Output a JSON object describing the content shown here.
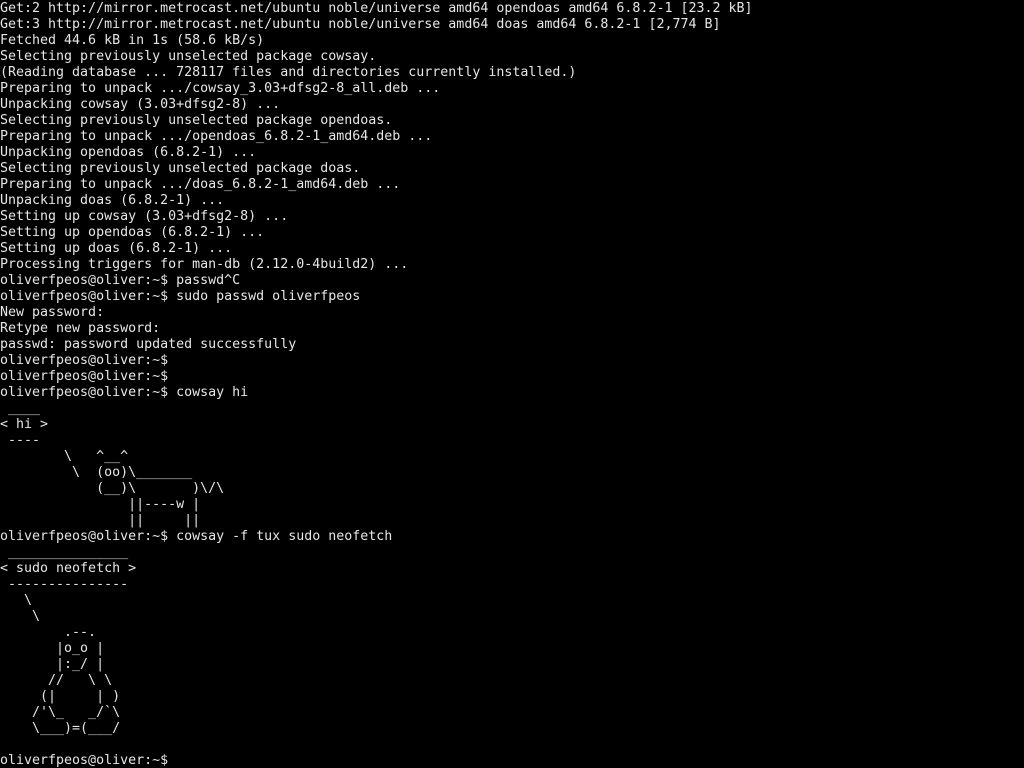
{
  "terminal": {
    "background": "#000000",
    "foreground": "#e6e6e6",
    "lines": [
      "Get:2 http://mirror.metrocast.net/ubuntu noble/universe amd64 opendoas amd64 6.8.2-1 [23.2 kB]",
      "Get:3 http://mirror.metrocast.net/ubuntu noble/universe amd64 doas amd64 6.8.2-1 [2,774 B]",
      "Fetched 44.6 kB in 1s (58.6 kB/s)",
      "Selecting previously unselected package cowsay.",
      "(Reading database ... 728117 files and directories currently installed.)",
      "Preparing to unpack .../cowsay_3.03+dfsg2-8_all.deb ...",
      "Unpacking cowsay (3.03+dfsg2-8) ...",
      "Selecting previously unselected package opendoas.",
      "Preparing to unpack .../opendoas_6.8.2-1_amd64.deb ...",
      "Unpacking opendoas (6.8.2-1) ...",
      "Selecting previously unselected package doas.",
      "Preparing to unpack .../doas_6.8.2-1_amd64.deb ...",
      "Unpacking doas (6.8.2-1) ...",
      "Setting up cowsay (3.03+dfsg2-8) ...",
      "Setting up opendoas (6.8.2-1) ...",
      "Setting up doas (6.8.2-1) ...",
      "Processing triggers for man-db (2.12.0-4build2) ...",
      "oliverfpeos@oliver:~$ passwd^C",
      "oliverfpeos@oliver:~$ sudo passwd oliverfpeos",
      "New password:",
      "Retype new password:",
      "passwd: password updated successfully",
      "oliverfpeos@oliver:~$",
      "oliverfpeos@oliver:~$",
      "oliverfpeos@oliver:~$ cowsay hi",
      " ____",
      "< hi >",
      " ----",
      "        \\   ^__^",
      "         \\  (oo)\\_______",
      "            (__)\\       )\\/\\",
      "                ||----w |",
      "                ||     ||",
      "oliverfpeos@oliver:~$ cowsay -f tux sudo neofetch",
      " _______________",
      "< sudo neofetch >",
      " ---------------",
      "   \\",
      "    \\",
      "        .--.",
      "       |o_o |",
      "       |:_/ |",
      "      //   \\ \\",
      "     (|     | )",
      "    /'\\_   _/`\\",
      "    \\___)=(___/",
      "",
      "oliverfpeos@oliver:~$"
    ]
  }
}
